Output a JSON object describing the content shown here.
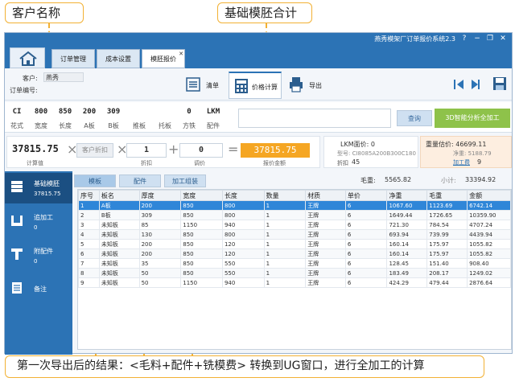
{
  "callouts": {
    "customer": "客户名称",
    "sum": "基础模胚合计",
    "bottom": "第一次导出后的结果：<毛料+配件+铣模费>    转换到UG窗口，进行全加工的计算"
  },
  "window": {
    "title": "燕秀模架厂订单报价系统2.3",
    "controls": [
      "?",
      "−",
      "❐",
      "✕"
    ]
  },
  "tabs": [
    {
      "label": "订单管理",
      "active": false
    },
    {
      "label": "成本设置",
      "active": false
    },
    {
      "label": "模胚报价",
      "active": true
    }
  ],
  "toolbar": {
    "customer_label": "客户:",
    "customer_value": "燕秀",
    "order_label": "订单编号:",
    "list_label": "清单",
    "calc_label": "价格计算",
    "export_label": "导出"
  },
  "params": [
    {
      "value": "CI",
      "label": "花式"
    },
    {
      "value": "800",
      "label": "宽度"
    },
    {
      "value": "850",
      "label": "长度"
    },
    {
      "value": "200",
      "label": "A板"
    },
    {
      "value": "309",
      "label": "B板"
    },
    {
      "value": "",
      "label": "推板"
    },
    {
      "value": "",
      "label": "托板"
    },
    {
      "value": "0",
      "label": "方铁"
    },
    {
      "value": "LKM",
      "label": "配件"
    }
  ],
  "buttons": {
    "query": "查询",
    "ai": "3D智能分析全加工"
  },
  "calc": {
    "base_value": "37815.75",
    "base_label": "计算值",
    "customer_discount": "客户折扣",
    "discount_value": "1",
    "discount_label": "折扣",
    "adjust_value": "0",
    "adjust_label": "调价",
    "quote_value": "37815.75",
    "quote_label": "报价金额",
    "lkm_area": "LKM面价: 0",
    "model_code": "型号: CI8085A200B300C180",
    "discount_text": "折扣",
    "discount_num": "45",
    "weight_est": "重量估价: 46699.11",
    "net_weight": "净重: 5188.79",
    "process_label": "加工费",
    "process_value": "9"
  },
  "sidebar": [
    {
      "title": "基础模胚",
      "value": "37815.75",
      "icon": "mold-icon",
      "active": true
    },
    {
      "title": "追加工",
      "value": "0",
      "icon": "machining-icon",
      "active": false
    },
    {
      "title": "附配件",
      "value": "0",
      "icon": "parts-icon",
      "active": false
    },
    {
      "title": "备注",
      "value": "",
      "icon": "notes-icon",
      "active": false
    }
  ],
  "subtabs": [
    "模板",
    "配件",
    "加工组装"
  ],
  "summary": {
    "gross_label": "毛重:",
    "gross_value": "5565.82",
    "subtotal_label": "小计:",
    "subtotal_value": "33394.92"
  },
  "table": {
    "headers": [
      "序号",
      "板名",
      "厚度",
      "宽度",
      "长度",
      "数量",
      "材质",
      "单价",
      "净重",
      "毛重",
      "金额"
    ],
    "rows": [
      [
        "1",
        "A板",
        "200",
        "850",
        "800",
        "1",
        "王牌",
        "6",
        "1067.60",
        "1123.69",
        "6742.14"
      ],
      [
        "2",
        "B板",
        "309",
        "850",
        "800",
        "1",
        "王牌",
        "6",
        "1649.44",
        "1726.65",
        "10359.90"
      ],
      [
        "3",
        "未知板",
        "85",
        "1150",
        "940",
        "1",
        "王牌",
        "6",
        "721.30",
        "784.54",
        "4707.24"
      ],
      [
        "4",
        "未知板",
        "130",
        "850",
        "800",
        "1",
        "王牌",
        "6",
        "693.94",
        "739.99",
        "4439.94"
      ],
      [
        "5",
        "未知板",
        "200",
        "850",
        "120",
        "1",
        "王牌",
        "6",
        "160.14",
        "175.97",
        "1055.82"
      ],
      [
        "6",
        "未知板",
        "200",
        "850",
        "120",
        "1",
        "王牌",
        "6",
        "160.14",
        "175.97",
        "1055.82"
      ],
      [
        "7",
        "未知板",
        "35",
        "850",
        "550",
        "1",
        "王牌",
        "6",
        "128.45",
        "151.40",
        "908.40"
      ],
      [
        "8",
        "未知板",
        "50",
        "850",
        "550",
        "1",
        "王牌",
        "6",
        "183.49",
        "208.17",
        "1249.02"
      ],
      [
        "9",
        "未知板",
        "50",
        "1150",
        "940",
        "1",
        "王牌",
        "6",
        "424.29",
        "479.44",
        "2876.64"
      ]
    ]
  },
  "colors": {
    "accent": "#2c73b5",
    "highlight": "#f5a623",
    "green": "#8ec24a",
    "callout_border": "#f2b134"
  }
}
